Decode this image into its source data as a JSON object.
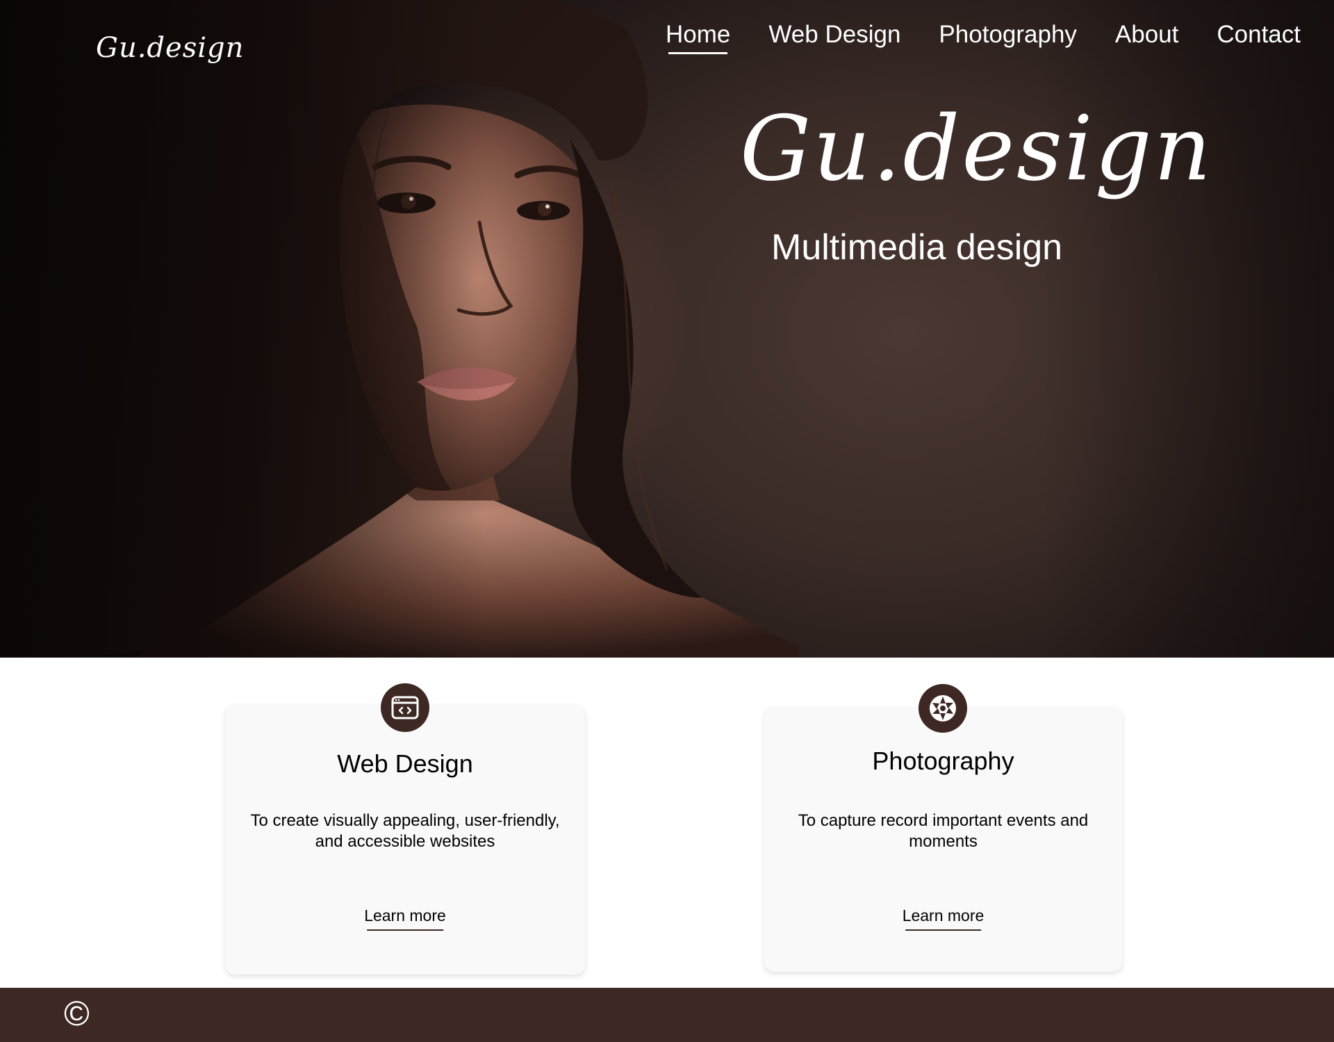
{
  "site": {
    "logo_text": "Gu.design"
  },
  "nav": {
    "items": [
      {
        "label": "Home",
        "active": true
      },
      {
        "label": "Web Design",
        "active": false
      },
      {
        "label": "Photography",
        "active": false
      },
      {
        "label": "About",
        "active": false
      },
      {
        "label": "Contact",
        "active": false
      }
    ]
  },
  "hero": {
    "title": "Gu.design",
    "subtitle": "Multimedia design"
  },
  "cards": [
    {
      "icon": "code-window-icon",
      "title": "Web Design",
      "description": "To create visually appealing, user-friendly, and accessible websites",
      "link_label": "Learn more"
    },
    {
      "icon": "camera-aperture-icon",
      "title": "Photography",
      "description": "To capture record important events and moments",
      "link_label": "Learn more"
    }
  ],
  "footer": {
    "copyright_symbol": "©"
  },
  "colors": {
    "brand_dark": "#3d2823",
    "card_bg": "#f9f9f9",
    "text_light": "#ffffff",
    "text_dark": "#000000"
  }
}
